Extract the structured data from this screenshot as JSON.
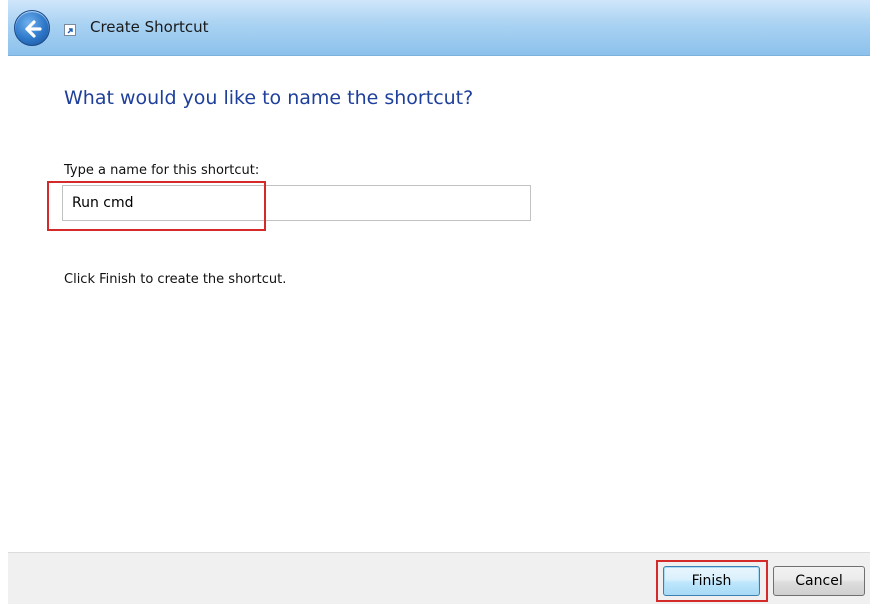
{
  "window": {
    "title": "Create Shortcut",
    "back_icon": "back-arrow-icon",
    "app_icon": "shortcut-icon"
  },
  "main": {
    "heading": "What would you like to name the shortcut?",
    "name_label": "Type a name for this shortcut:",
    "name_value": "Run cmd",
    "instructions": "Click Finish to create the shortcut."
  },
  "footer": {
    "finish_label": "Finish",
    "cancel_label": "Cancel"
  },
  "colors": {
    "heading": "#1e3f9b",
    "highlight": "#d42a2a",
    "titlebar": "#a9d2f2"
  }
}
